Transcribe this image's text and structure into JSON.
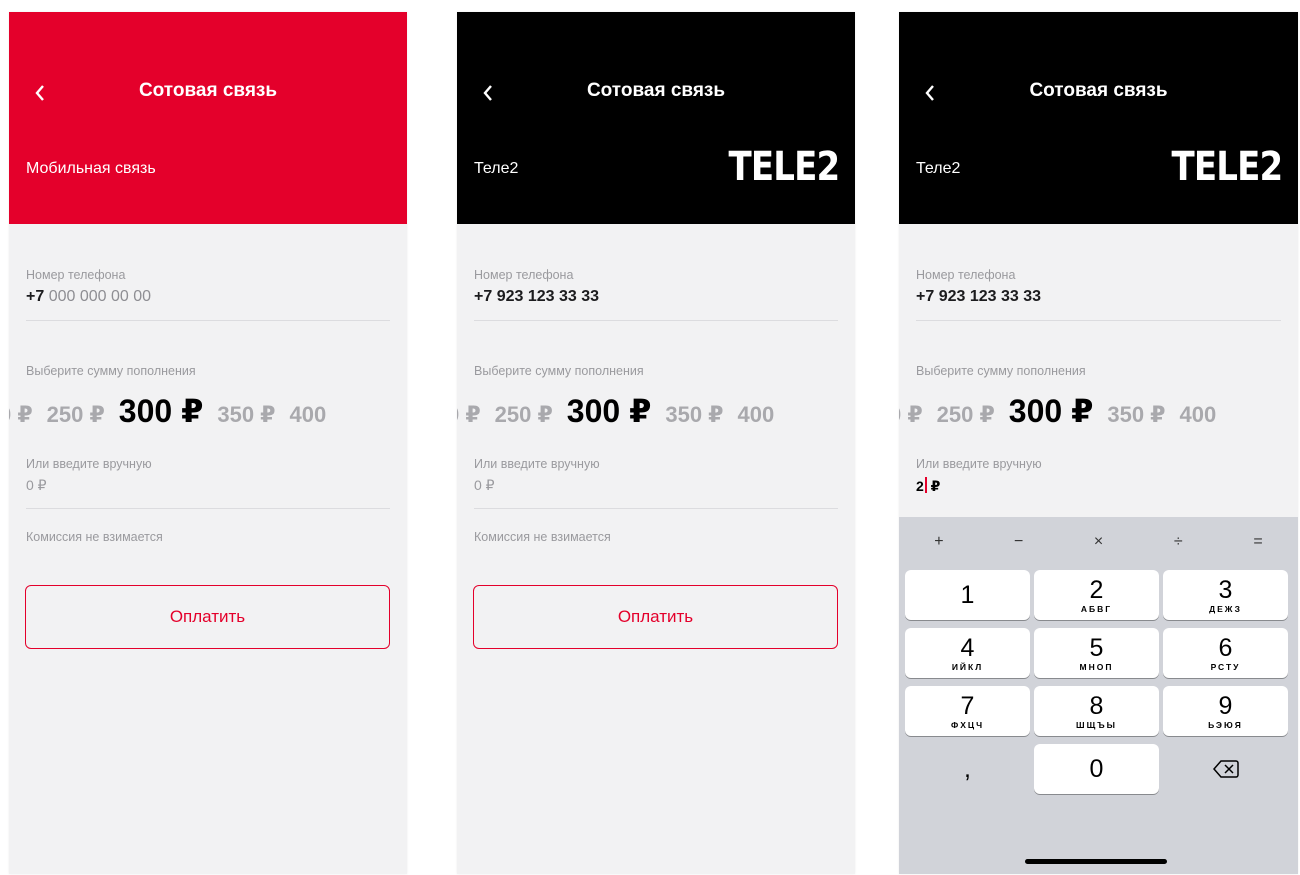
{
  "colors": {
    "accent": "#e4002b",
    "tele2_bg": "#000000",
    "screen_bg": "#f2f2f3"
  },
  "screens": [
    {
      "title": "Сотовая связь",
      "operator": "Мобильная связь",
      "phone_label": "Номер телефона",
      "phone_code": "+7",
      "phone_placeholder": " 000 000 00 00",
      "amount_label": "Выберите сумму пополнения",
      "amounts": [
        "0 ₽",
        "250 ₽",
        "300 ₽",
        "350 ₽",
        "400"
      ],
      "selected_amount": "300 ₽",
      "manual_label": "Или введите вручную",
      "manual_value": "0 ₽",
      "commission": "Комиссия не взимается",
      "pay_label": "Оплатить"
    },
    {
      "title": "Сотовая связь",
      "operator": "Теле2",
      "logo": "TELE2",
      "phone_label": "Номер телефона",
      "phone_value": "+7 923 123 33 33",
      "amount_label": "Выберите сумму пополнения",
      "amounts": [
        "0 ₽",
        "250 ₽",
        "300 ₽",
        "350 ₽",
        "400"
      ],
      "manual_label": "Или введите вручную",
      "manual_value": "0 ₽",
      "commission": "Комиссия не взимается",
      "pay_label": "Оплатить"
    },
    {
      "title": "Сотовая связь",
      "operator": "Теле2",
      "logo": "TELE2",
      "phone_label": "Номер телефона",
      "phone_value": "+7 923 123 33 33",
      "amount_label": "Выберите сумму пополнения",
      "amounts": [
        "0 ₽",
        "250 ₽",
        "300 ₽",
        "350 ₽",
        "400"
      ],
      "manual_label": "Или введите вручную",
      "manual_digit": "2",
      "manual_currency": " ₽"
    }
  ],
  "keyboard": {
    "ops": [
      "+",
      "−",
      "×",
      "÷",
      "="
    ],
    "keys": [
      {
        "digit": "1",
        "letters": ""
      },
      {
        "digit": "2",
        "letters": "АБВГ"
      },
      {
        "digit": "3",
        "letters": "ДЕЖЗ"
      },
      {
        "digit": "4",
        "letters": "ИЙКЛ"
      },
      {
        "digit": "5",
        "letters": "МНОП"
      },
      {
        "digit": "6",
        "letters": "РСТУ"
      },
      {
        "digit": "7",
        "letters": "ФХЦЧ"
      },
      {
        "digit": "8",
        "letters": "ШЩЪЫ"
      },
      {
        "digit": "9",
        "letters": "ЬЭЮЯ"
      },
      {
        "digit": ",",
        "letters": ""
      },
      {
        "digit": "0",
        "letters": ""
      }
    ],
    "backspace_icon": "backspace-icon"
  }
}
